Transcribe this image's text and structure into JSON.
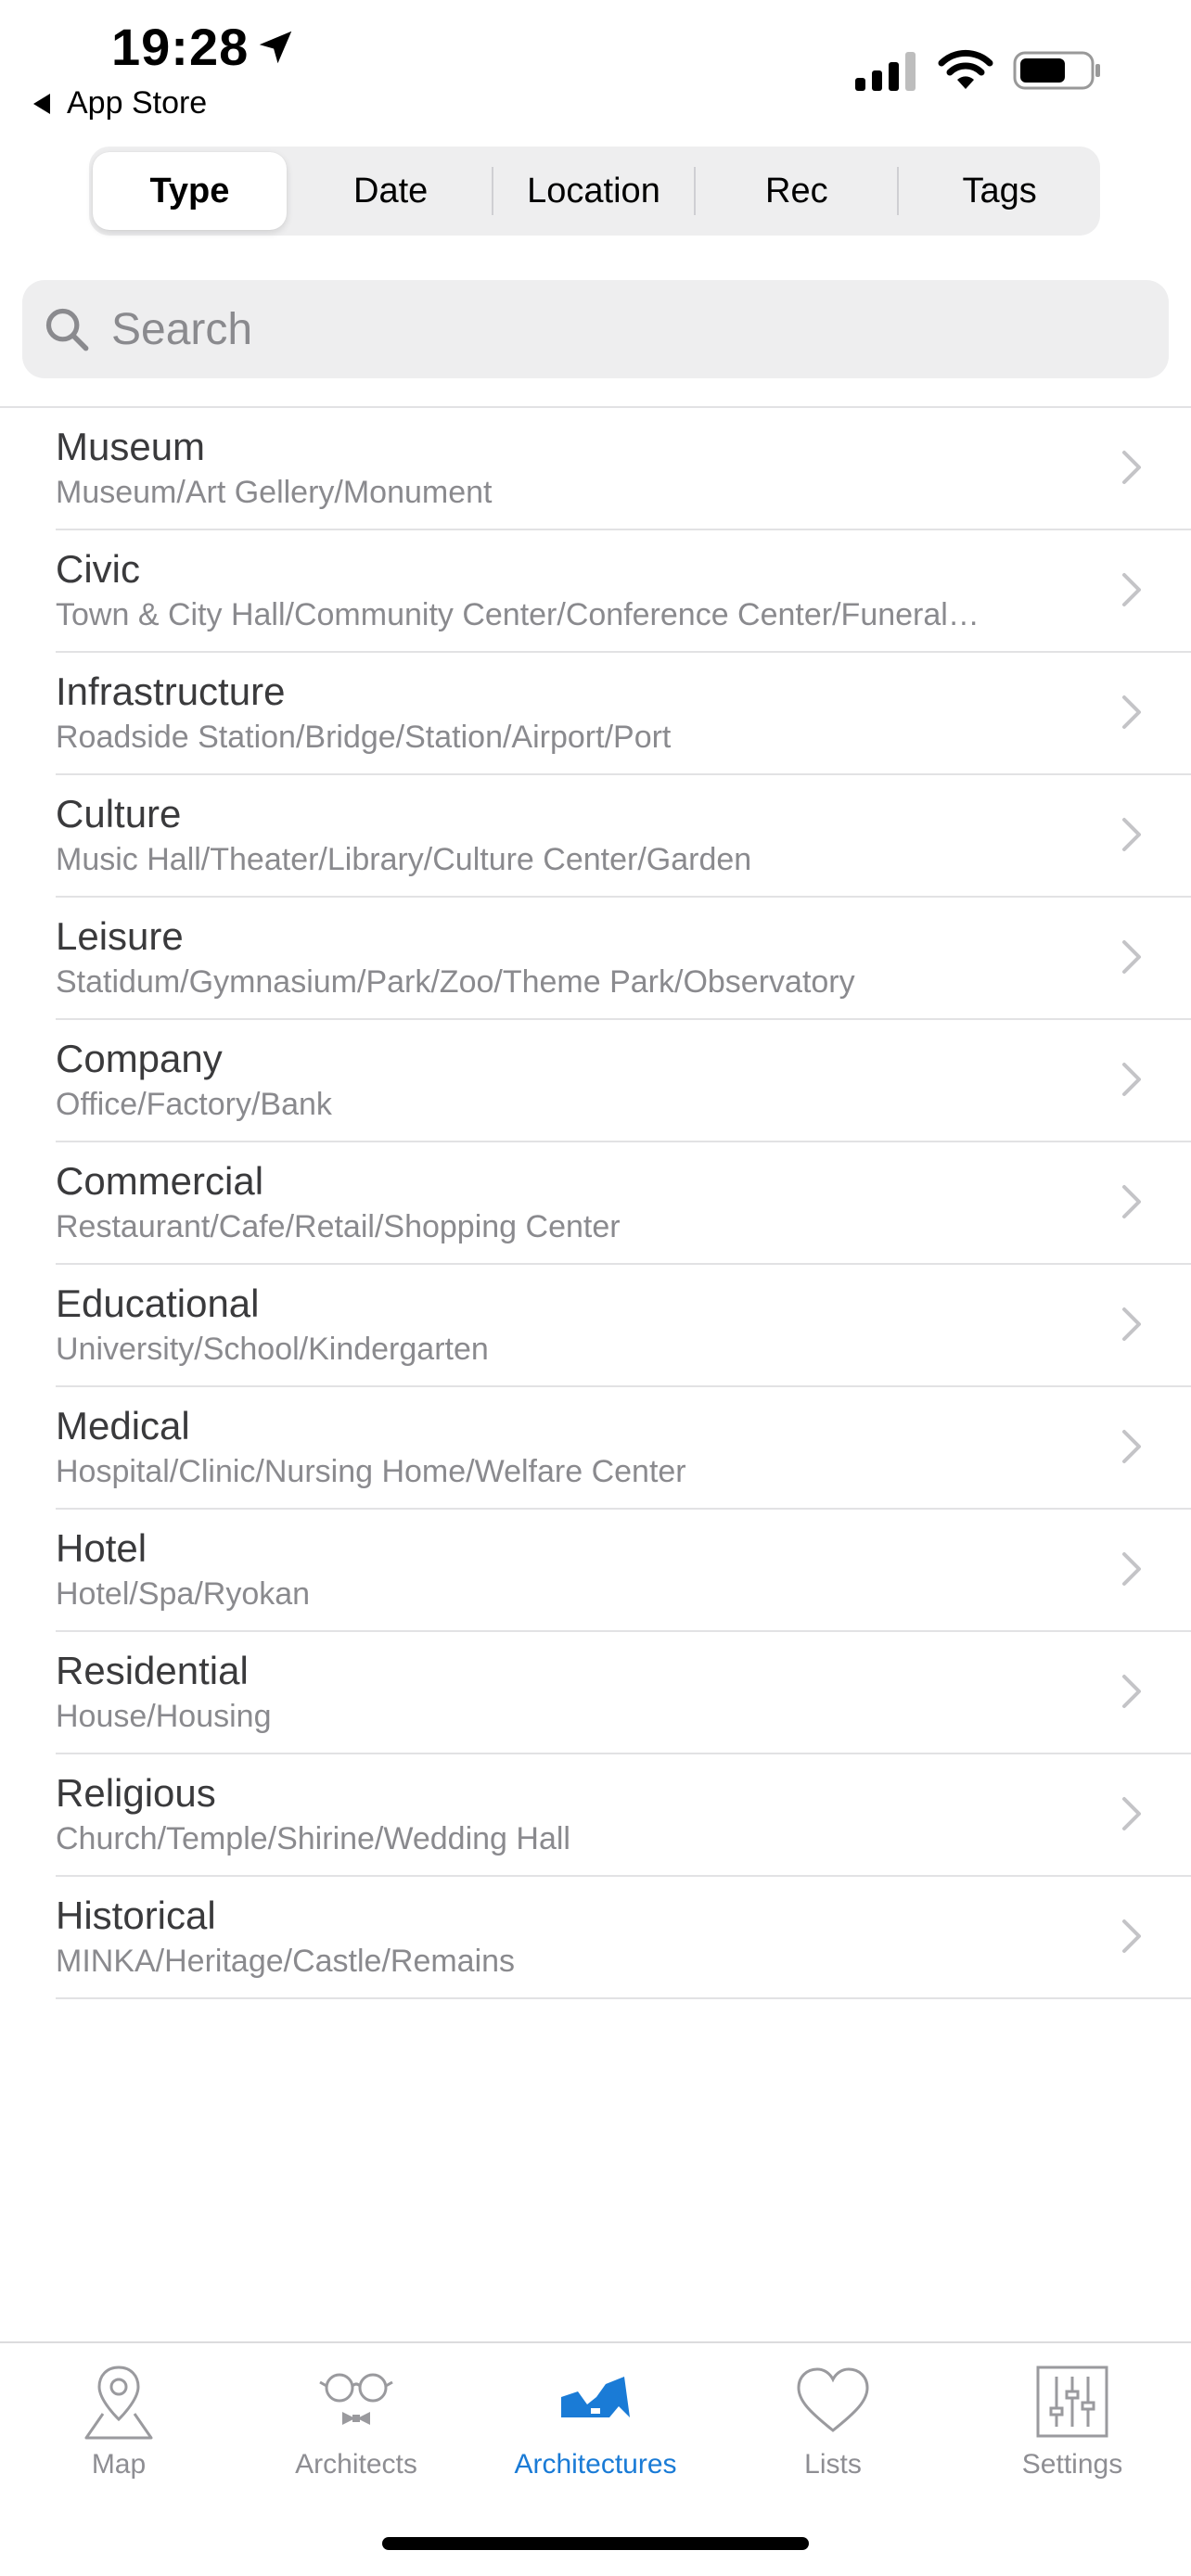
{
  "status_bar": {
    "time": "19:28",
    "back_label": "App Store"
  },
  "segments": [
    {
      "label": "Type",
      "active": true
    },
    {
      "label": "Date",
      "active": false
    },
    {
      "label": "Location",
      "active": false
    },
    {
      "label": "Rec",
      "active": false
    },
    {
      "label": "Tags",
      "active": false
    }
  ],
  "search": {
    "placeholder": "Search",
    "value": ""
  },
  "categories": [
    {
      "title": "Museum",
      "subtitle": "Museum/Art Gellery/Monument"
    },
    {
      "title": "Civic",
      "subtitle": "Town & City Hall/Community Center/Conference Center/Funeral…"
    },
    {
      "title": "Infrastructure",
      "subtitle": "Roadside Station/Bridge/Station/Airport/Port"
    },
    {
      "title": "Culture",
      "subtitle": "Music Hall/Theater/Library/Culture Center/Garden"
    },
    {
      "title": "Leisure",
      "subtitle": "Statidum/Gymnasium/Park/Zoo/Theme Park/Observatory"
    },
    {
      "title": "Company",
      "subtitle": "Office/Factory/Bank"
    },
    {
      "title": "Commercial",
      "subtitle": "Restaurant/Cafe/Retail/Shopping Center"
    },
    {
      "title": "Educational",
      "subtitle": "University/School/Kindergarten"
    },
    {
      "title": "Medical",
      "subtitle": "Hospital/Clinic/Nursing Home/Welfare Center"
    },
    {
      "title": "Hotel",
      "subtitle": "Hotel/Spa/Ryokan"
    },
    {
      "title": "Residential",
      "subtitle": "House/Housing"
    },
    {
      "title": "Religious",
      "subtitle": "Church/Temple/Shirine/Wedding Hall"
    },
    {
      "title": "Historical",
      "subtitle": "MINKA/Heritage/Castle/Remains"
    }
  ],
  "tabbar": [
    {
      "label": "Map",
      "icon": "map-pin-icon",
      "active": false
    },
    {
      "label": "Architects",
      "icon": "glasses-bowtie-icon",
      "active": false
    },
    {
      "label": "Architectures",
      "icon": "building-icon",
      "active": true
    },
    {
      "label": "Lists",
      "icon": "heart-icon",
      "active": false
    },
    {
      "label": "Settings",
      "icon": "sliders-icon",
      "active": false
    }
  ],
  "colors": {
    "accent": "#1a7bd6",
    "inactive": "#8e8e93",
    "segment_bg": "#eeeeef"
  }
}
